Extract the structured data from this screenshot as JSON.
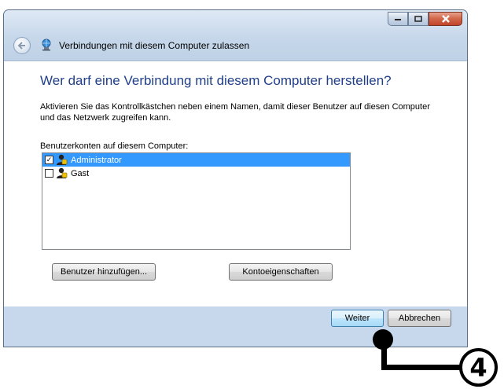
{
  "window": {
    "title": "Verbindungen mit diesem Computer zulassen"
  },
  "content": {
    "heading": "Wer darf eine Verbindung mit diesem Computer herstellen?",
    "description": "Aktivieren Sie das Kontrollkästchen neben einem Namen, damit dieser Benutzer auf diesen Computer und das Netzwerk zugreifen kann.",
    "list_label": "Benutzerkonten auf diesem Computer:",
    "accounts": [
      {
        "name": "Administrator",
        "checked": true,
        "selected": true,
        "icon": "user-account-icon"
      },
      {
        "name": "Gast",
        "checked": false,
        "selected": false,
        "icon": "user-account-icon"
      }
    ],
    "add_user_label": "Benutzer hinzufügen...",
    "account_properties_label": "Kontoeigenschaften"
  },
  "footer": {
    "next_label": "Weiter",
    "cancel_label": "Abbrechen"
  },
  "annotation": {
    "number": "4"
  },
  "colors": {
    "selection": "#3399ff",
    "heading": "#1f3f8a",
    "close_button": "#c0442a"
  }
}
